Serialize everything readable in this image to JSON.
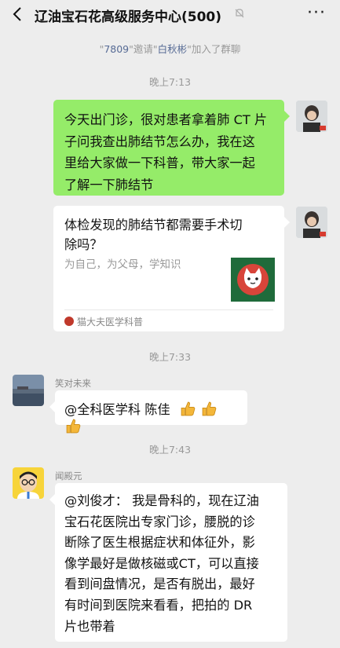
{
  "header": {
    "title": "辽油宝石花高级服务中心(500)",
    "back_icon": "chevron-left-icon",
    "mute_icon": "bell-off-icon",
    "more_label": "···"
  },
  "system_notice": {
    "inviter": "7809",
    "verb": "邀请",
    "invitee": "白秋彬",
    "suffix": "加入了群聊"
  },
  "timestamps": [
    "晚上7:13",
    "晚上7:33",
    "晚上7:43"
  ],
  "messages": {
    "self_text": {
      "lines": [
        "今天出门诊，很对患者拿着肺 CT 片",
        "子问我查出肺结节怎么办，我在这",
        "里给大家做一下科普，带大家一起",
        "了解一下肺结节"
      ]
    },
    "self_card": {
      "title_lines": [
        "体检发现的肺结节都需要手术切",
        "除吗？"
      ],
      "description": "为自己，为父母，学知识",
      "source": "猫大夫医学科普"
    },
    "msg3": {
      "sender": "笑对未来",
      "text": "@全科医学科 陈佳",
      "emoji": "thumbs-up-icon"
    },
    "msg4": {
      "sender": "闻殿元",
      "lines": [
        "@刘俊才： 我是骨科的，现在辽油",
        "宝石花医院出专家门诊，腰脱的诊",
        "断除了医生根据症状和体征外，影",
        "像学最好是做核磁或CT，可以直接",
        "看到间盘情况，是否有脱出，最好",
        "有时间到医院来看看，把拍的 DR",
        "片也带着"
      ]
    }
  },
  "colors": {
    "background": "#ededed",
    "self_bubble": "#95ec69",
    "link": "#576b95"
  }
}
